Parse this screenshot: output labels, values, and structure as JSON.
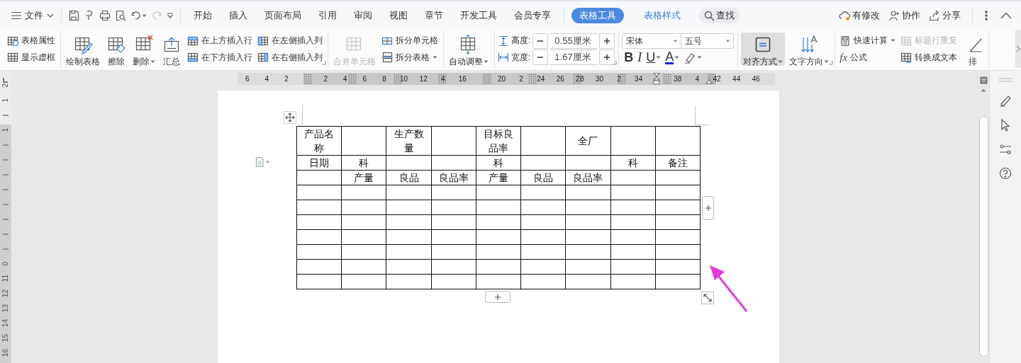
{
  "menu_bar": {
    "file_menu": "文件",
    "tabs": [
      {
        "label": "开始",
        "kind": "tab",
        "selected": false
      },
      {
        "label": "插入",
        "kind": "tab",
        "selected": false
      },
      {
        "label": "页面布局",
        "kind": "tab",
        "selected": false
      },
      {
        "label": "引用",
        "kind": "tab",
        "selected": false
      },
      {
        "label": "审阅",
        "kind": "tab",
        "selected": false
      },
      {
        "label": "视图",
        "kind": "tab",
        "selected": false
      },
      {
        "label": "章节",
        "kind": "tab",
        "selected": false
      },
      {
        "label": "开发工具",
        "kind": "tab",
        "selected": false
      },
      {
        "label": "会员专享",
        "kind": "tab",
        "selected": false
      },
      {
        "label": "表格工具",
        "kind": "context",
        "selected": true
      },
      {
        "label": "表格样式",
        "kind": "context",
        "selected": false
      }
    ],
    "search": "查找",
    "actions": [
      {
        "label": "有修改",
        "kind": "modified"
      },
      {
        "label": "协作",
        "kind": "collaborate"
      },
      {
        "label": "分享",
        "kind": "share"
      }
    ]
  },
  "ribbon": [
    {
      "columns": [
        {
          "kind": "stack",
          "items": [
            {
              "label": "表格属性",
              "disabled": false
            },
            {
              "label": "显示虚框",
              "disabled": false
            }
          ]
        }
      ]
    },
    {
      "launcher": true,
      "columns": [
        {
          "kind": "large",
          "label": "绘制表格",
          "disabled": false,
          "selected": false
        },
        {
          "kind": "large",
          "label": "擦除",
          "disabled": false,
          "selected": false
        },
        {
          "kind": "large",
          "label": "删除",
          "dropdown": true,
          "disabled": false,
          "selected": false
        },
        {
          "kind": "large",
          "label": "汇总",
          "disabled": false,
          "selected": false
        },
        {
          "kind": "stack",
          "items": [
            {
              "label": "在上方插入行",
              "disabled": false
            },
            {
              "label": "在下方插入行",
              "disabled": false
            }
          ]
        },
        {
          "kind": "stack",
          "items": [
            {
              "label": "在左侧插入列",
              "disabled": false
            },
            {
              "label": "在右侧插入列",
              "disabled": false
            }
          ]
        }
      ]
    },
    {
      "columns": [
        {
          "kind": "large",
          "label": "合并单元格",
          "disabled": true,
          "selected": false
        },
        {
          "kind": "stack",
          "items": [
            {
              "label": "拆分单元格",
              "disabled": false
            },
            {
              "label": "拆分表格",
              "dropdown": true,
              "disabled": false
            }
          ]
        }
      ]
    },
    {
      "columns": [
        {
          "kind": "large",
          "label": "自动调整",
          "dropdown": true,
          "disabled": false,
          "selected": false
        }
      ]
    },
    {
      "launcher": true,
      "columns": [
        {
          "kind": "size",
          "rows": [
            {
              "label": "高度:",
              "value": "0.55厘米"
            },
            {
              "label": "宽度:",
              "value": "1.67厘米"
            }
          ]
        }
      ]
    },
    {
      "columns": [
        {
          "kind": "font",
          "font_name": "宋体",
          "font_size": "五号",
          "format": [
            {
              "label": "B",
              "kind": "bold"
            },
            {
              "label": "I",
              "kind": "italic"
            },
            {
              "label": "U",
              "kind": "underline",
              "dropdown": true
            },
            {
              "label": "A",
              "kind": "font-color",
              "dropdown": true
            },
            {
              "kind": "highlight",
              "dropdown": true
            }
          ]
        }
      ]
    },
    {
      "launcher": true,
      "columns": [
        {
          "kind": "large",
          "label": "对齐方式",
          "dropdown": true,
          "disabled": false,
          "selected": true
        },
        {
          "kind": "large",
          "label": "文字方向",
          "dropdown": true,
          "disabled": false,
          "selected": false
        }
      ]
    },
    {
      "columns": [
        {
          "kind": "stack",
          "items": [
            {
              "label": "快速计算",
              "dropdown": true,
              "disabled": false
            },
            {
              "label": "公式",
              "prefix": "fx",
              "disabled": false
            }
          ]
        },
        {
          "kind": "stack",
          "items": [
            {
              "label": "标题行重复",
              "disabled": true
            },
            {
              "label": "转换成文本",
              "disabled": false
            }
          ]
        },
        {
          "kind": "large",
          "label": "排",
          "disabled": false,
          "selected": false
        }
      ]
    }
  ],
  "ruler": [
    [
      "6",
      "4",
      "2"
    ],
    [
      "2",
      "4",
      "6",
      "8",
      "10",
      "12",
      "4",
      "16"
    ],
    [
      "20",
      "2",
      "24",
      "26",
      "28",
      "30",
      "2",
      "34"
    ],
    [
      "38",
      "4",
      "42",
      "44",
      "46"
    ]
  ],
  "vertical_ruler": [
    {
      "label": "2"
    },
    {
      "label": "1"
    },
    {
      "kind": "gap"
    },
    {
      "label": "1"
    },
    {
      "kind": "gap"
    },
    {
      "kind": "gap"
    },
    {
      "kind": "gap"
    },
    {
      "kind": "gap"
    },
    {
      "kind": "gap"
    },
    {
      "kind": "gap"
    },
    {
      "kind": "gap"
    },
    {
      "kind": "gap"
    },
    {
      "label": "0"
    },
    {
      "label": "11"
    },
    {
      "label": "12"
    },
    {
      "label": "13"
    },
    {
      "label": "14"
    },
    {
      "label": "15"
    },
    {
      "label": "16"
    }
  ],
  "table": {
    "rows": [
      [
        "产品名称",
        null,
        "生产数量",
        null,
        "目标良品率",
        null,
        "全厂",
        null,
        null
      ],
      [
        "日期",
        "科",
        null,
        null,
        "科",
        null,
        null,
        "科",
        "备注"
      ],
      [
        null,
        "产量",
        "良品",
        "良品率",
        "产量",
        "良品",
        "良品率",
        null,
        null
      ],
      [
        null,
        null,
        null,
        null,
        null,
        null,
        null,
        null,
        null
      ],
      [
        null,
        null,
        null,
        null,
        null,
        null,
        null,
        null,
        null
      ],
      [
        null,
        null,
        null,
        null,
        null,
        null,
        null,
        null,
        null
      ],
      [
        null,
        null,
        null,
        null,
        null,
        null,
        null,
        null,
        null
      ],
      [
        null,
        null,
        null,
        null,
        null,
        null,
        null,
        null,
        null
      ],
      [
        null,
        null,
        null,
        null,
        null,
        null,
        null,
        null,
        null
      ],
      [
        null,
        null,
        null,
        null,
        null,
        null,
        null,
        null,
        null
      ]
    ]
  }
}
